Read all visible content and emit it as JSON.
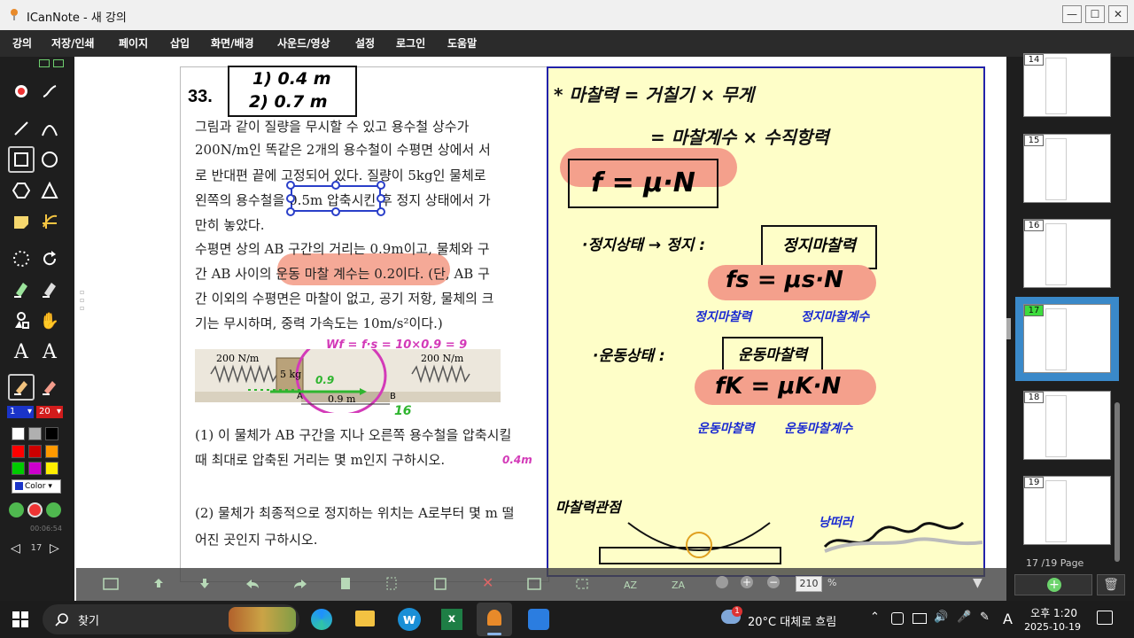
{
  "window": {
    "title": "ICanNote - 새 강의"
  },
  "menu": [
    "강의",
    "저장/인쇄",
    "페이지",
    "삽입",
    "화면/배경",
    "사운드/영상",
    "설정",
    "로그인",
    "도움말"
  ],
  "toolbar": {
    "pen_width": "1",
    "eraser_size": "20",
    "color_label": "Color",
    "timer": "00:06:54",
    "page_input": "17",
    "palette": [
      "#ffffff",
      "#b0b0b0",
      "#000000",
      "#ff0000",
      "#cc0000",
      "#ff9900",
      "#00cc00",
      "#cc00cc",
      "#ffee00"
    ]
  },
  "worksheet": {
    "number": "33.",
    "answer_box": [
      "1) 0.4 m",
      "2) 0.7 m"
    ],
    "problem_lines": [
      "그림과 같이 질량을 무시할 수 있고 용수철 상수가",
      "200N/m인 똑같은 2개의 용수철이 수평면 상에서 서",
      "로 반대편 끝에 고정되어 있다. 질량이 5kg인 물체로",
      "왼쪽의 용수철을 0.5m 압축시킨 후 정지 상태에서 가",
      "만히 놓았다.",
      "수평면 상의 AB 구간의 거리는 0.9m이고, 물체와 구",
      "간 AB 사이의 운동 마찰 계수는 0.2이다. (단, AB 구",
      "간 이외의 수평면은 마찰이 없고, 공기 저항, 물체의 크",
      "기는 무시하며, 중력 가속도는 10m/s²이다.)"
    ],
    "figure": {
      "spring_left": "200 N/m",
      "spring_right": "200 N/m",
      "mass": "5 kg",
      "distance": "0.9 m",
      "label_a": "A",
      "label_b": "B"
    },
    "handwriting": {
      "work": "Wf = f·s = 10×0.9 = 9",
      "val1": "0.9",
      "val16": "16",
      "answer1": "0.4m"
    },
    "questions": [
      "(1) 이 물체가 AB 구간을 지나 오른쪽 용수철을 압축시킬",
      "때 최대로 압축된 거리는 몇 m인지 구하시오.",
      "(2) 물체가 최종적으로 정지하는 위치는 A로부터 몇 m 떨",
      "어진 곳인지 구하시오."
    ]
  },
  "notes": {
    "line1": "* 마찰력 = 거칠기 × 무게",
    "line2": "= 마찰계수 × 수직항력",
    "formula_main": "f = μ·N",
    "static_title": "·정지상태 → 정지 :",
    "static_box": "정지마찰력",
    "static_formula": "fs = μs·N",
    "static_sub1": "정지마찰력",
    "static_sub2": "정지마찰계수",
    "kinetic_title": "·운동상태 :",
    "kinetic_box": "운동마찰력",
    "kinetic_formula": "fK = μK·N",
    "kinetic_sub1": "운동마찰력",
    "kinetic_sub2": "운동마찰계수",
    "bottom_left": "마찰력관점",
    "bottom_right": "낭떠러"
  },
  "bottombar": {
    "zoom": "210",
    "zoom_unit": "%"
  },
  "pages": {
    "thumbnails": [
      "14",
      "15",
      "16",
      "17",
      "18",
      "19"
    ],
    "current": "17",
    "indicator": "17",
    "total": "/19 Page"
  },
  "taskbar": {
    "search": "찾기",
    "weather": "20°C  대체로 흐림",
    "weather_badge": "1",
    "ampm": "오후 1:20",
    "date": "2025-10-19",
    "ime": "A"
  }
}
